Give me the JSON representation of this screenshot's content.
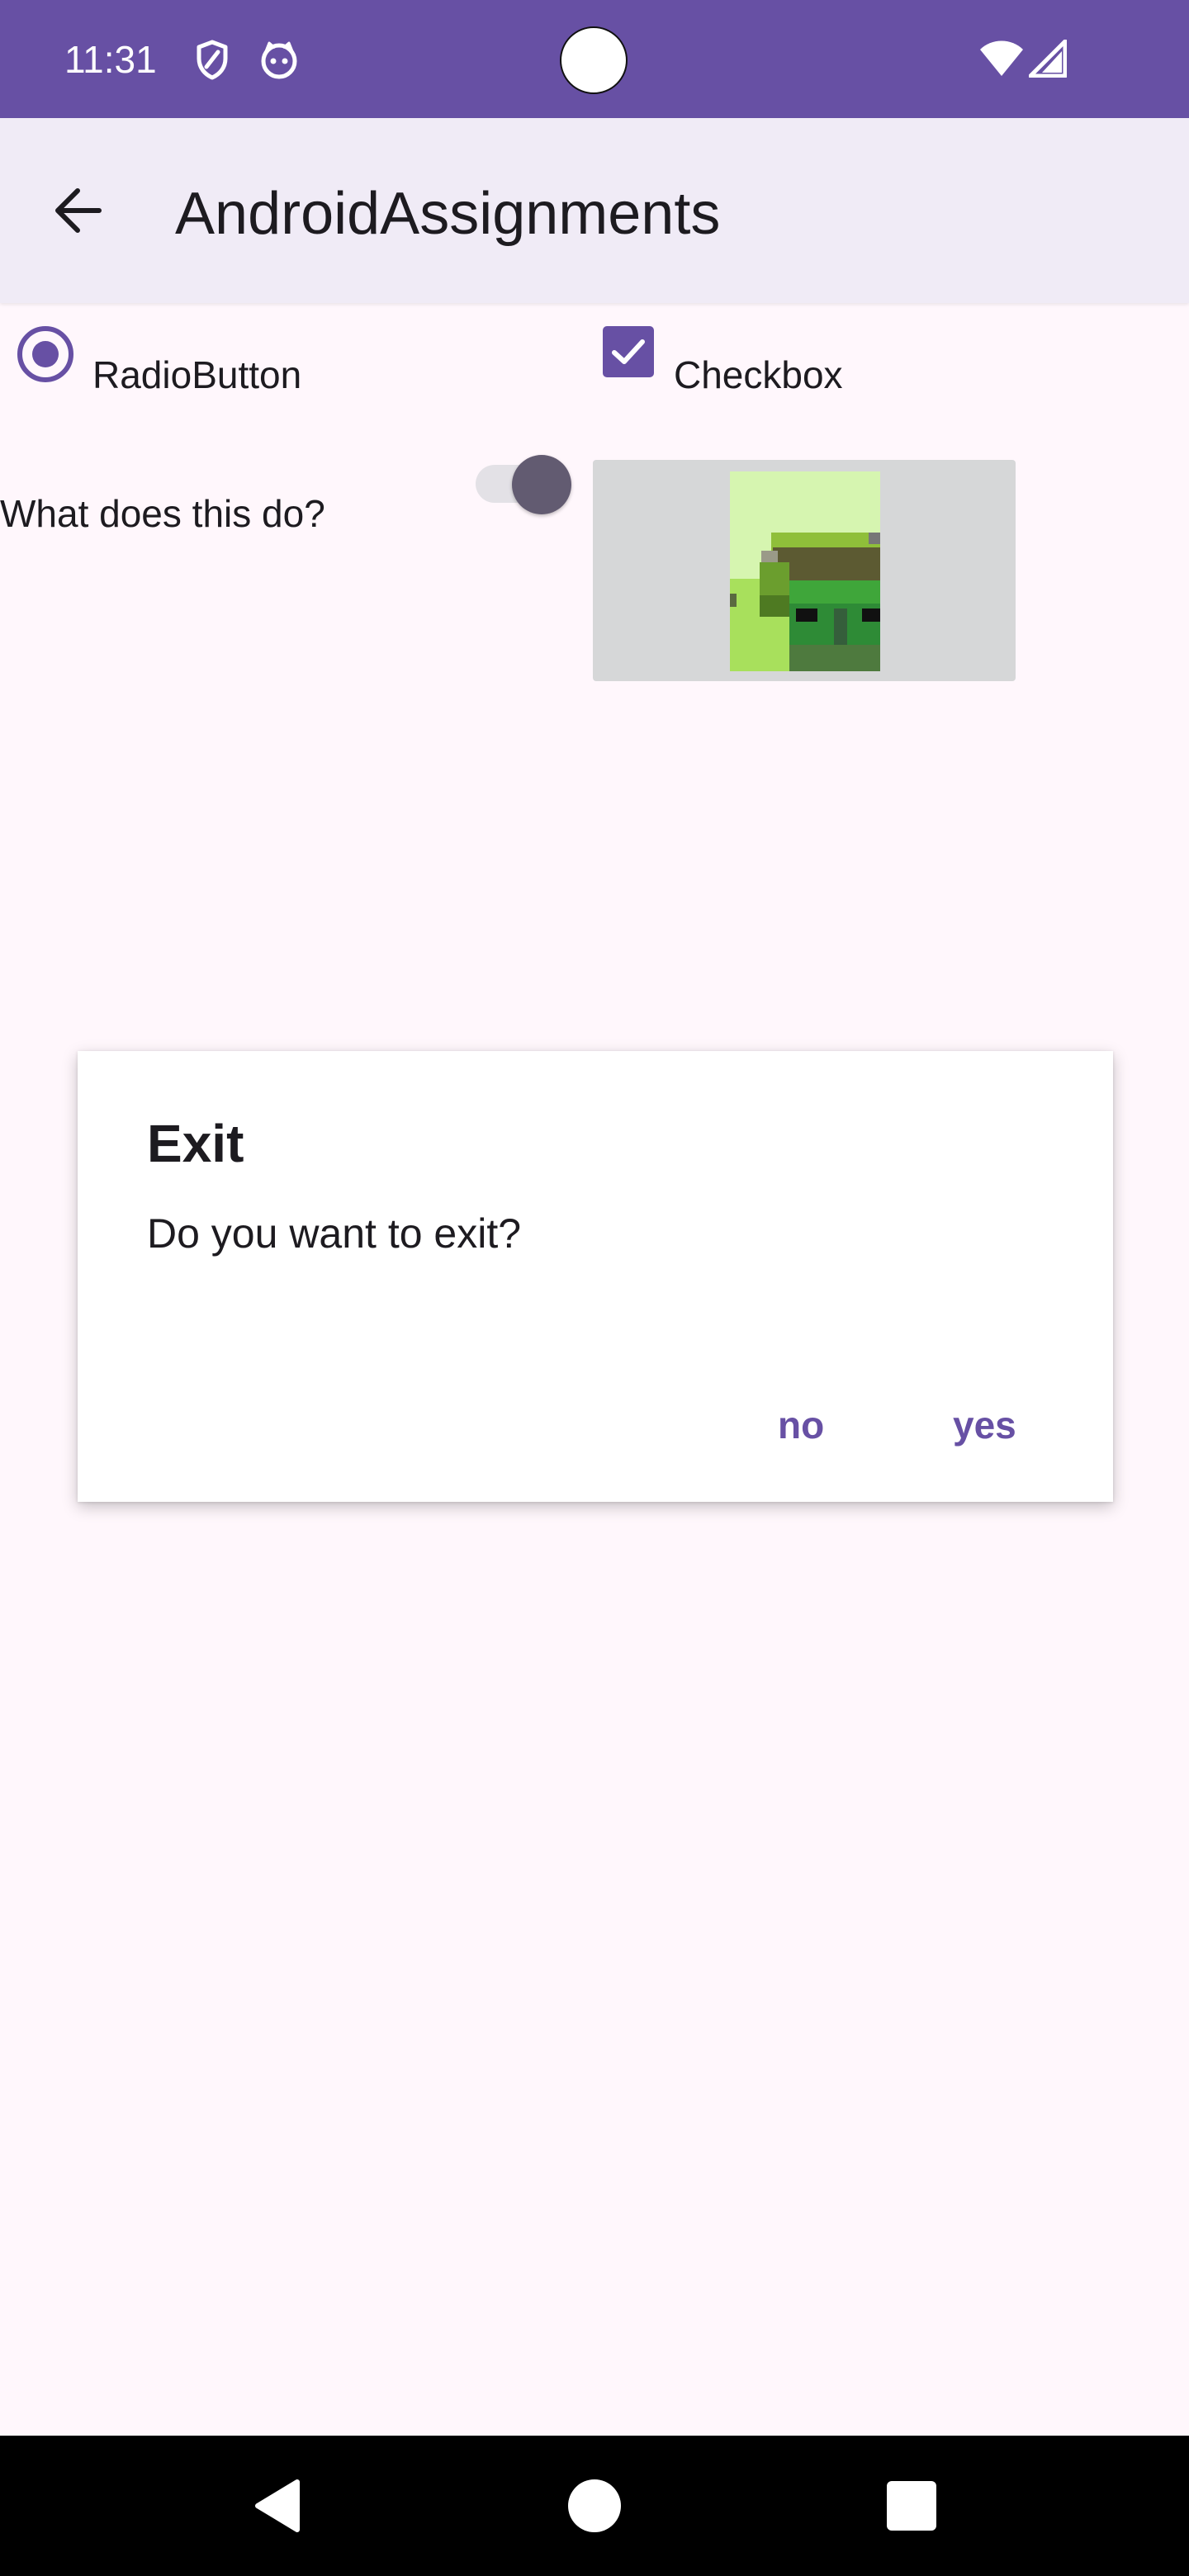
{
  "status_bar": {
    "time": "11:31",
    "icons": [
      "shield-icon",
      "cat-face-icon",
      "wifi-icon",
      "cellular-signal-icon"
    ]
  },
  "app_bar": {
    "title": "AndroidAssignments",
    "back_icon": "arrow-back-icon"
  },
  "controls": {
    "radio_label": "RadioButton",
    "radio_checked": true,
    "checkbox_label": "Checkbox",
    "checkbox_checked": true,
    "switch_label": "What does this do?",
    "switch_on": true,
    "image": "pixel-art-character-icon"
  },
  "dialog": {
    "title": "Exit",
    "message": "Do you want to exit?",
    "negative_label": "no",
    "positive_label": "yes"
  },
  "nav_bar": {
    "icons": [
      "nav-back-icon",
      "nav-home-icon",
      "nav-recents-icon"
    ]
  },
  "colors": {
    "primary": "#6750A4",
    "app_bar_bg": "#F0EBF6",
    "background": "#FFF7FC",
    "switch_thumb": "#625B71",
    "on_surface": "#1D1B20"
  }
}
